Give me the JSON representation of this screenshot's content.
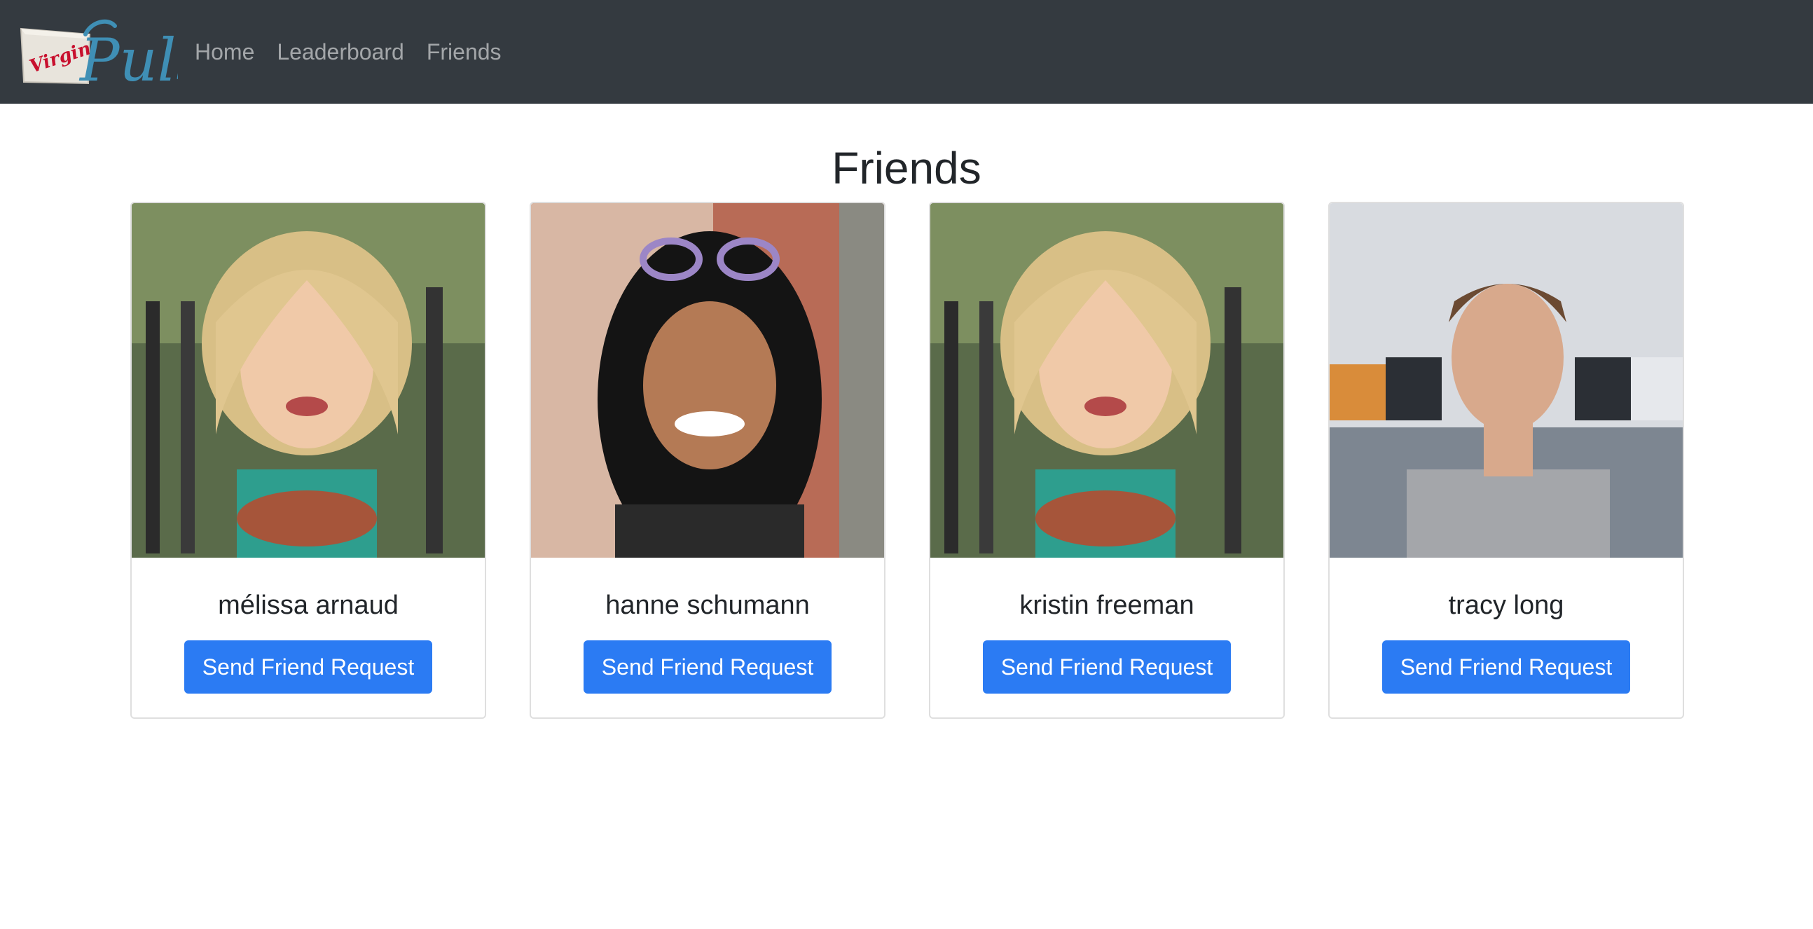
{
  "nav": {
    "brand": "Virgin Pulse",
    "links": [
      "Home",
      "Leaderboard",
      "Friends"
    ]
  },
  "page": {
    "title": "Friends"
  },
  "friends": [
    {
      "name": "mélissa arnaud",
      "button": "Send Friend Request"
    },
    {
      "name": "hanne schumann",
      "button": "Send Friend Request"
    },
    {
      "name": "kristin freeman",
      "button": "Send Friend Request"
    },
    {
      "name": "tracy long",
      "button": "Send Friend Request"
    }
  ],
  "colors": {
    "navbar": "#343a40",
    "primary_button": "#2b7bf3"
  }
}
